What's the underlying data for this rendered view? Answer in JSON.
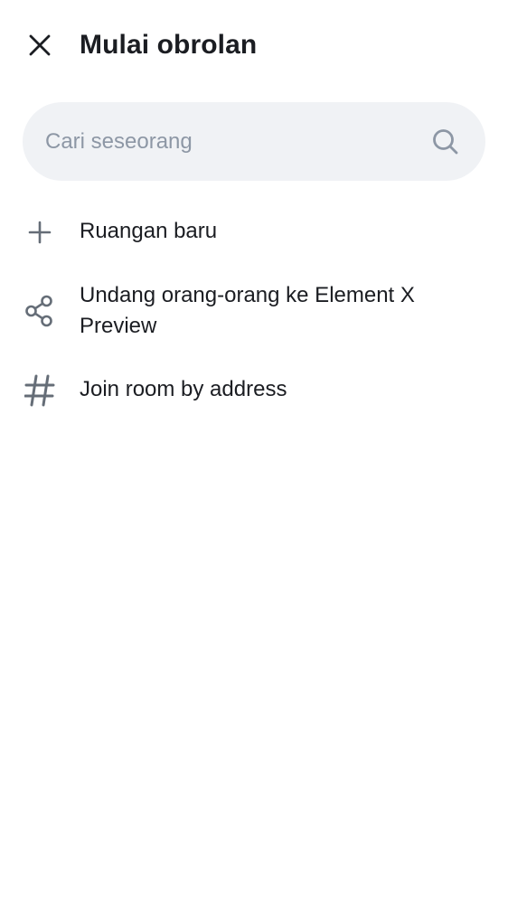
{
  "header": {
    "title": "Mulai obrolan",
    "close_icon": "close-icon"
  },
  "search": {
    "placeholder": "Cari seseorang",
    "value": "",
    "icon": "search-icon"
  },
  "menu": {
    "items": [
      {
        "label": "Ruangan baru",
        "icon": "plus-icon"
      },
      {
        "label": "Undang orang-orang ke Element X Preview",
        "icon": "share-icon"
      },
      {
        "label": "Join room by address",
        "icon": "hashtag-icon"
      }
    ]
  },
  "colors": {
    "text": "#1b1d22",
    "icon": "#656d77",
    "search_bg": "#f0f2f5",
    "placeholder": "#8d97a5"
  }
}
